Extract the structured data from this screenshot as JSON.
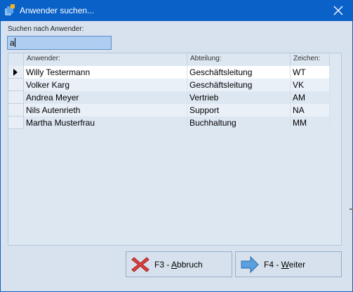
{
  "window": {
    "title": "Anwender suchen..."
  },
  "search": {
    "label": "Suchen nach Anwender:",
    "value": "a"
  },
  "table": {
    "columns": [
      "Anwender:",
      "Abteilung:",
      "Zeichen:"
    ],
    "rows": [
      {
        "name": "Willy Testermann",
        "department": "Geschäftsleitung",
        "code": "WT",
        "selected": true
      },
      {
        "name": "Volker Karg",
        "department": "Geschäftsleitung",
        "code": "VK",
        "selected": false
      },
      {
        "name": "Andrea Meyer",
        "department": "Vertrieb",
        "code": "AM",
        "selected": false
      },
      {
        "name": "Nils Autenrieth",
        "department": "Support",
        "code": "NA",
        "selected": false
      },
      {
        "name": "Martha Musterfrau",
        "department": "Buchhaltung",
        "code": "MM",
        "selected": false
      }
    ]
  },
  "buttons": {
    "cancel": {
      "prefix": "F3 - ",
      "accel": "A",
      "rest": "bbruch",
      "icon": "red-x-icon"
    },
    "next": {
      "prefix": "F4 - ",
      "accel": "W",
      "rest": "eiter",
      "icon": "right-arrow-icon"
    }
  },
  "colors": {
    "titlebar": "#0a62c9",
    "selection_input": "#aecdf0",
    "window_bg": "#d7e2ee"
  }
}
